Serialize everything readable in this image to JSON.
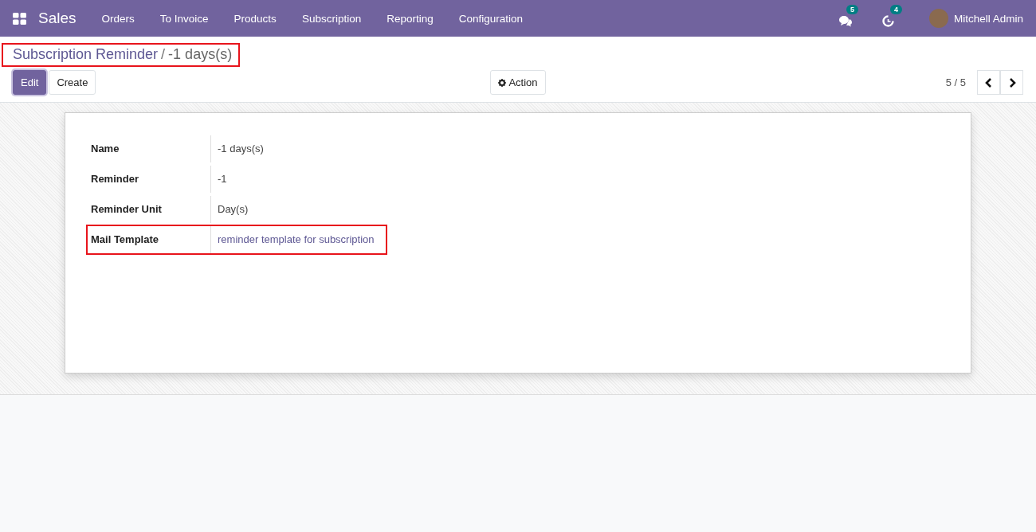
{
  "navbar": {
    "app": "Sales",
    "menu": [
      "Orders",
      "To Invoice",
      "Products",
      "Subscription",
      "Reporting",
      "Configuration"
    ],
    "messages_count": "5",
    "activities_count": "4",
    "user": "Mitchell Admin"
  },
  "breadcrumb": {
    "parent": "Subscription Reminder",
    "separator": "/",
    "current": "-1 days(s)",
    "highlighted": true
  },
  "buttons": {
    "edit": "Edit",
    "create": "Create",
    "action": "Action"
  },
  "pager": {
    "counter": "5 / 5"
  },
  "fields": [
    {
      "label": "Name",
      "value": "-1 days(s)",
      "kind": "text",
      "highlighted": false
    },
    {
      "label": "Reminder",
      "value": "-1",
      "kind": "text",
      "highlighted": false
    },
    {
      "label": "Reminder Unit",
      "value": "Day(s)",
      "kind": "text",
      "highlighted": false
    },
    {
      "label": "Mail Template",
      "value": "reminder template for subscription",
      "kind": "link",
      "highlighted": true
    }
  ]
}
